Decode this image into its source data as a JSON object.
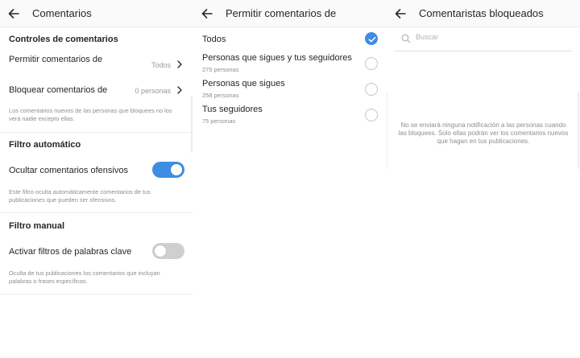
{
  "panel_comentarios": {
    "title": "Comentarios",
    "section_controls": "Controles de comentarios",
    "allow_row": {
      "label": "Permitir comentarios de",
      "value": "Todos"
    },
    "block_row": {
      "label": "Bloquear comentarios de",
      "value": "0 personas"
    },
    "block_help": "Los comentarios nuevos de las personas que bloquees no los verá nadie excepto ellas.",
    "section_auto": "Filtro automático",
    "hide_offensive": {
      "label": "Ocultar comentarios ofensivos",
      "enabled": true
    },
    "auto_help": "Este filtro oculta automáticamente comentarios de tus publicaciones que pueden ser ofensivos.",
    "section_manual": "Filtro manual",
    "keyword_filters": {
      "label": "Activar filtros de palabras clave",
      "enabled": false
    },
    "manual_help": "Oculta de tus publicaciones los comentarios que incluyan palabras o frases específicas."
  },
  "panel_permitir": {
    "title": "Permitir comentarios de",
    "options": [
      {
        "label": "Todos",
        "sub": "",
        "selected": true
      },
      {
        "label": "Personas que sigues y tus seguidores",
        "sub": "275 personas",
        "selected": false
      },
      {
        "label": "Personas que sigues",
        "sub": "258 personas",
        "selected": false
      },
      {
        "label": "Tus seguidores",
        "sub": "75 personas",
        "selected": false
      }
    ]
  },
  "panel_bloqueados": {
    "title": "Comentaristas bloqueados",
    "search_placeholder": "Buscar",
    "empty_message": "No se enviará ninguna notificación a las personas cuando las bloquees. Solo ellas podrán ver los comentarios nuevos que hagan en tus publicaciones."
  },
  "colors": {
    "accent": "#3f8de3",
    "toggle_off": "#cfcfcf",
    "secondary_text": "#8e8e8e"
  },
  "icons": {
    "back": "arrow-left-icon",
    "chevron": "chevron-right-icon",
    "search": "search-icon",
    "check": "checkmark-icon"
  }
}
